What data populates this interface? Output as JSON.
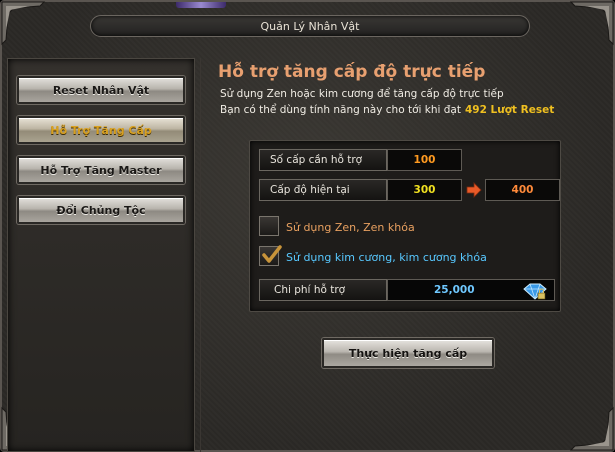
{
  "window": {
    "title": "Quản Lý Nhân Vật"
  },
  "menu": {
    "items": [
      {
        "label": "Reset Nhân Vật",
        "active": false
      },
      {
        "label": "Hỗ Trợ Tăng Cấp",
        "active": true
      },
      {
        "label": "Hỗ Trợ Tăng Master",
        "active": false
      },
      {
        "label": "Đổi Chủng Tộc",
        "active": false
      }
    ]
  },
  "content": {
    "heading": "Hỗ trợ tăng cấp độ trực tiếp",
    "description_line1": "Sử dụng Zen hoặc kim cương để tăng cấp độ trực tiếp",
    "description_line2": "Bạn có thể dùng tính năng này cho tới khi đạt",
    "reset_limit": "492 Lượt Reset",
    "fields": {
      "levels_needed_label": "Số cấp cần hỗ trợ",
      "levels_needed_value": "100",
      "current_level_label": "Cấp độ hiện tại",
      "current_level_value": "300",
      "target_level_value": "400"
    },
    "options": {
      "zen_label": "Sử dụng Zen, Zen khóa",
      "zen_checked": false,
      "diamond_label": "Sử dụng kim cương, kim cương khóa",
      "diamond_checked": true
    },
    "cost": {
      "label": "Chi phí hỗ trợ",
      "value": "25,000",
      "currency_icon": "diamond-lock-icon"
    },
    "action_button": "Thực hiện tăng cấp"
  },
  "colors": {
    "heading": "#e8a070",
    "active_menu_text": "#d8a020",
    "reset_highlight": "#f0c020",
    "levels_needed": "#ff9a20",
    "current_level": "#f0e020",
    "target_level": "#ff8a3a",
    "zen_option": "#e8a060",
    "diamond_option": "#58c8ff",
    "cost_value": "#6fc8ff",
    "arrow": "#e85a28"
  }
}
